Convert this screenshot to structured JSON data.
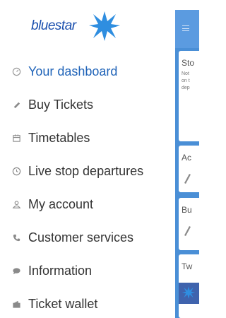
{
  "logo": {
    "text": "bluestar",
    "brand_color": "#1a4fae",
    "star_color": "#2f8ee0"
  },
  "menu": {
    "items": [
      {
        "label": "Your dashboard",
        "icon": "dashboard-gauge-icon",
        "active": true
      },
      {
        "label": "Buy Tickets",
        "icon": "ticket-icon",
        "active": false
      },
      {
        "label": "Timetables",
        "icon": "calendar-icon",
        "active": false
      },
      {
        "label": "Live stop departures",
        "icon": "clock-icon",
        "active": false
      },
      {
        "label": "My account",
        "icon": "user-icon",
        "active": false
      },
      {
        "label": "Customer services",
        "icon": "phone-icon",
        "active": false
      },
      {
        "label": "Information",
        "icon": "speech-bubble-icon",
        "active": false
      },
      {
        "label": "Ticket wallet",
        "icon": "wallet-icon",
        "active": false
      }
    ],
    "active_color": "#1f63b8",
    "text_color": "#333333"
  },
  "app_panel": {
    "header_color": "#5b9be0",
    "background_color": "#4a8fd6",
    "cards": [
      {
        "title": "Sto",
        "body": [
          "Not",
          "on t",
          "dep"
        ]
      },
      {
        "title": "Ac"
      },
      {
        "title": "Bu"
      },
      {
        "title": "Tw"
      }
    ]
  }
}
